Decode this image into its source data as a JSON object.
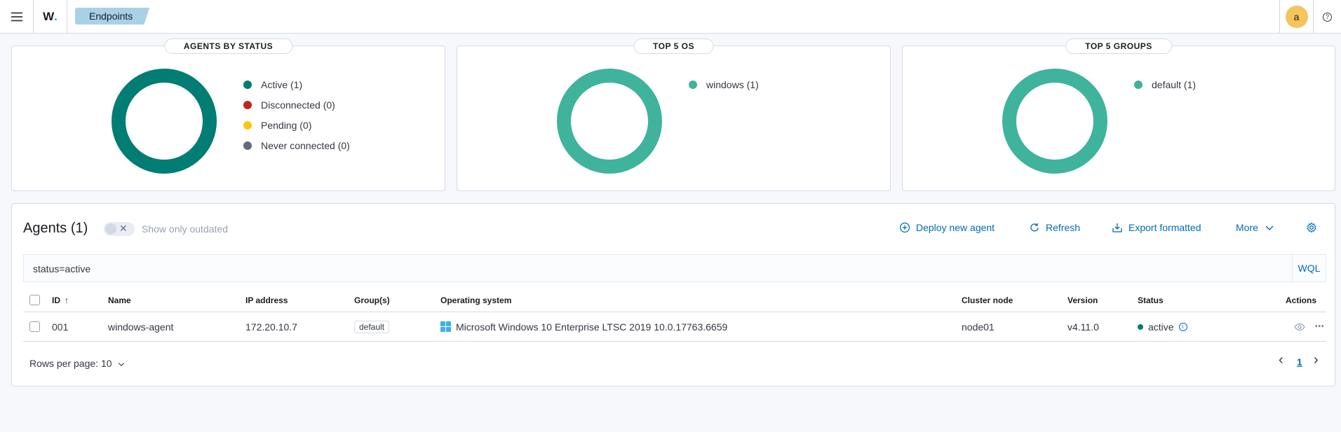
{
  "header": {
    "logo_text": "W",
    "logo_dot": ".",
    "breadcrumb": "Endpoints",
    "avatar_initial": "a",
    "help_symbol": "?"
  },
  "panels": [
    {
      "title": "AGENTS BY STATUS",
      "chart_color": "#017d73",
      "legend": [
        {
          "label": "Active (1)",
          "color": "#017d73"
        },
        {
          "label": "Disconnected (0)",
          "color": "#bd271e"
        },
        {
          "label": "Pending (0)",
          "color": "#fec514"
        },
        {
          "label": "Never connected (0)",
          "color": "#646a77"
        }
      ]
    },
    {
      "title": "TOP 5 OS",
      "chart_color": "#3fb39b",
      "legend": [
        {
          "label": "windows (1)",
          "color": "#3fb39b"
        }
      ]
    },
    {
      "title": "TOP 5 GROUPS",
      "chart_color": "#3fb39b",
      "legend": [
        {
          "label": "default (1)",
          "color": "#3fb39b"
        }
      ]
    }
  ],
  "chart_data": [
    {
      "type": "pie",
      "title": "AGENTS BY STATUS",
      "categories": [
        "Active",
        "Disconnected",
        "Pending",
        "Never connected"
      ],
      "values": [
        1,
        0,
        0,
        0
      ],
      "legend": "right"
    },
    {
      "type": "pie",
      "title": "TOP 5 OS",
      "categories": [
        "windows"
      ],
      "values": [
        1
      ],
      "legend": "right"
    },
    {
      "type": "pie",
      "title": "TOP 5 GROUPS",
      "categories": [
        "default"
      ],
      "values": [
        1
      ],
      "legend": "right"
    }
  ],
  "agents": {
    "title": "Agents (1)",
    "toggle_label": "Show only outdated",
    "toggle_x": "✕",
    "actions": {
      "deploy": "Deploy new agent",
      "refresh": "Refresh",
      "export": "Export formatted",
      "more": "More"
    },
    "search": {
      "value": "status=active",
      "wql": "WQL"
    },
    "columns": {
      "id": "ID",
      "sort_arrow": "↑",
      "name": "Name",
      "ip": "IP address",
      "groups": "Group(s)",
      "os": "Operating system",
      "cluster": "Cluster node",
      "version": "Version",
      "status": "Status",
      "actions": "Actions"
    },
    "rows": [
      {
        "id": "001",
        "name": "windows-agent",
        "ip": "172.20.10.7",
        "group": "default",
        "os": "Microsoft Windows 10 Enterprise LTSC 2019 10.0.17763.6659",
        "cluster": "node01",
        "version": "v4.11.0",
        "status": "active",
        "status_info": "i",
        "more_actions": "•••"
      }
    ],
    "pagination": {
      "rows_per_page": "Rows per page: 10",
      "prev": "‹",
      "page": "1",
      "next": "›"
    }
  }
}
